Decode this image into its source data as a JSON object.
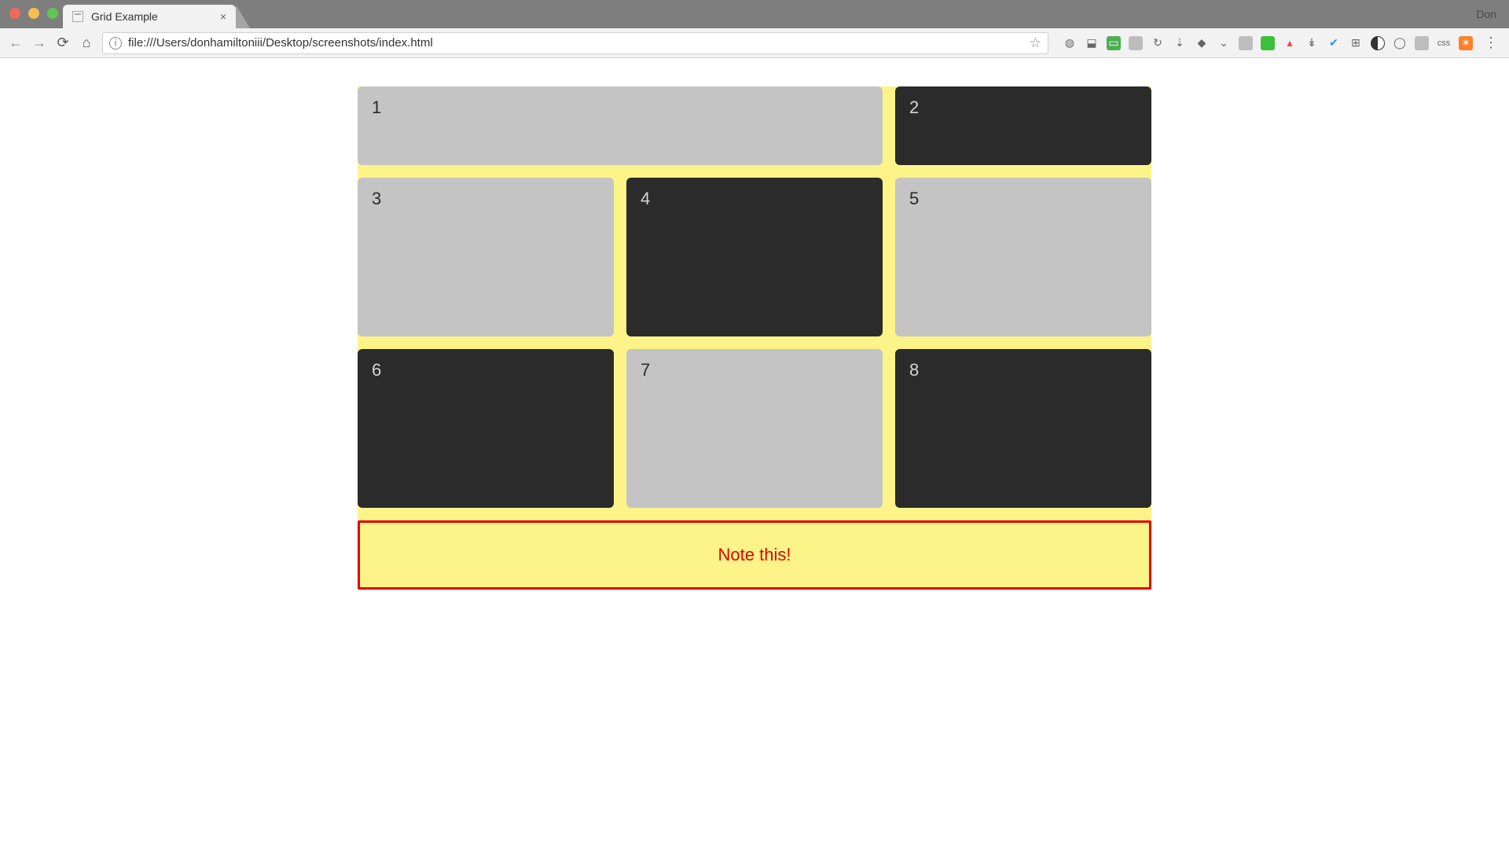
{
  "chrome": {
    "profile_name": "Don",
    "tab_title": "Grid Example",
    "url": "file:///Users/donhamiltoniii/Desktop/screenshots/index.html",
    "ext_css_label": "css"
  },
  "grid": {
    "cells": {
      "c1": "1",
      "c2": "2",
      "c3": "3",
      "c4": "4",
      "c5": "5",
      "c6": "6",
      "c7": "7",
      "c8": "8"
    },
    "note_text": "Note this!"
  }
}
